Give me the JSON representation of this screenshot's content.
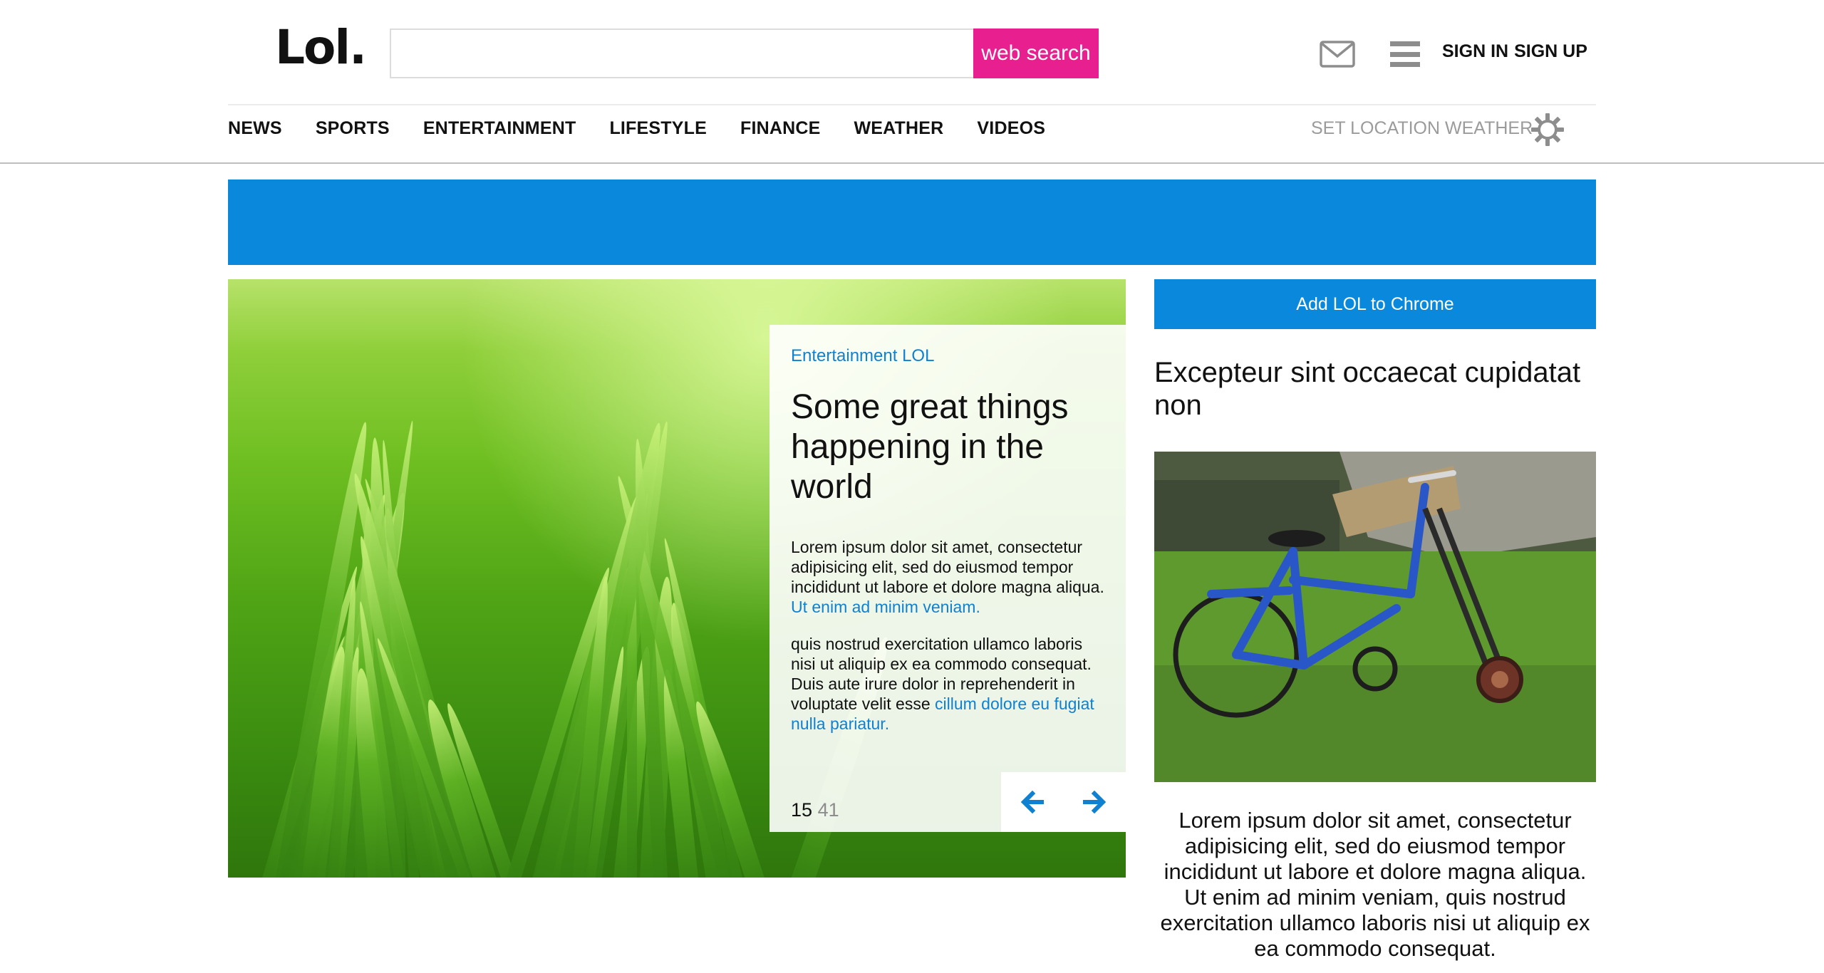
{
  "header": {
    "logo": "Lol.",
    "search": {
      "value": "",
      "placeholder": "",
      "button_label": "web search"
    },
    "auth": {
      "sign_in": "SIGN IN",
      "sign_up": "SIGN UP"
    }
  },
  "nav": {
    "items": [
      "NEWS",
      "SPORTS",
      "ENTERTAINMENT",
      "LIFESTYLE",
      "FINANCE",
      "WEATHER",
      "VIDEOS"
    ],
    "location_label": "SET LOCATION WEATHER"
  },
  "hero": {
    "category": "Entertainment LOL",
    "title": "Some great things happening in the world",
    "paragraph1": "Lorem ipsum dolor sit amet, consectetur adipisicing elit, sed do eiusmod tempor incididunt ut labore et dolore magna aliqua.",
    "paragraph1_link": "Ut enim ad minim veniam.",
    "paragraph2": "quis nostrud exercitation ullamco laboris nisi ut aliquip ex ea commodo consequat. Duis aute irure dolor in reprehenderit in voluptate velit esse",
    "paragraph2_link": "cillum dolore eu fugiat nulla pariatur.",
    "counter_current": "15",
    "counter_total": "41"
  },
  "sidebar": {
    "chrome_button": "Add LOL to Chrome",
    "title": "Excepteur sint occaecat cupidatat non",
    "text": "Lorem ipsum dolor sit amet, consectetur adipisicing elit, sed do eiusmod tempor incididunt ut labore et dolore magna aliqua. Ut enim ad minim veniam, quis nostrud exercitation ullamco laboris nisi ut aliquip ex ea commodo consequat."
  },
  "colors": {
    "accent_pink": "#e8208f",
    "accent_blue": "#0a89dc",
    "link_blue": "#1080d0"
  },
  "icons": [
    "mail-icon",
    "menu-icon",
    "gear-icon",
    "arrow-left-icon",
    "arrow-right-icon"
  ]
}
